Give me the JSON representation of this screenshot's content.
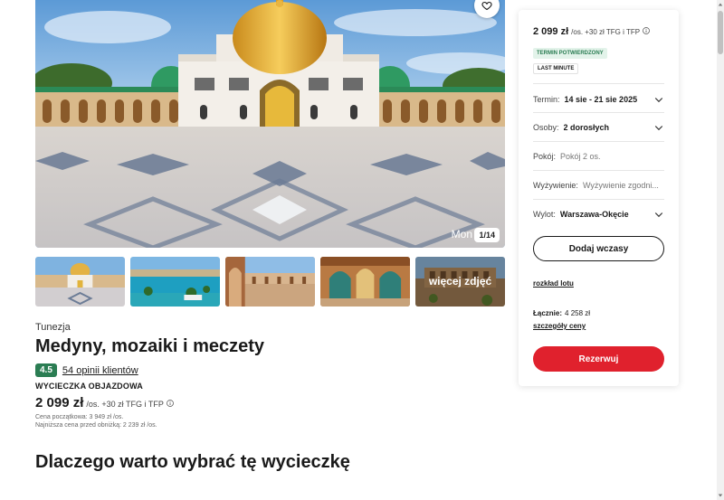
{
  "gallery": {
    "caption": "Mon",
    "counter": "1/14",
    "more_label": "więcej zdjęć",
    "thumbnails": [
      "mosque-courtyard",
      "beach-resort",
      "arches-courtyard",
      "ornate-interior",
      "amphitheatre"
    ]
  },
  "offer": {
    "country": "Tunezja",
    "title": "Medyny, mozaiki i meczety",
    "rating": "4.5",
    "reviews": "54 opinii klientów",
    "trip_type": "WYCIECZKA OBJAZDOWA",
    "price": "2 099 zł",
    "price_suffix": "/os. +30 zł TFG i TFP",
    "start_price_note": "Cena początkowa: 3 949 zł /os.",
    "lowest_price_note": "Najniższa cena przed obniżką: 2 239 zł /os.",
    "why_heading": "Dlaczego warto wybrać tę wycieczkę"
  },
  "sidebar": {
    "price": "2 099 zł",
    "price_suffix": "/os. +30 zł TFG i TFP",
    "badge_confirmed": "TERMIN POTWIERDZONY",
    "badge_last_minute": "LAST MINUTE",
    "term_label": "Termin:",
    "term_value": "14 sie - 21 sie 2025",
    "persons_label": "Osoby:",
    "persons_value": "2 dorosłych",
    "room_label": "Pokój:",
    "room_value": "Pokój 2 os.",
    "board_label": "Wyżywienie:",
    "board_value": "Wyżywienie zgodni...",
    "departure_label": "Wylot:",
    "departure_value": "Warszawa-Okęcie",
    "add_button": "Dodaj wczasy",
    "flight_plan_link": "rozkład lotu",
    "total_label": "Łącznie:",
    "total_value": "4 258 zł",
    "price_details_link": "szczegóły ceny",
    "reserve_button": "Rezerwuj"
  },
  "colors": {
    "accent_red": "#e0212d",
    "rating_green": "#2b7d53",
    "badge_green_bg": "#e3f3ea"
  }
}
